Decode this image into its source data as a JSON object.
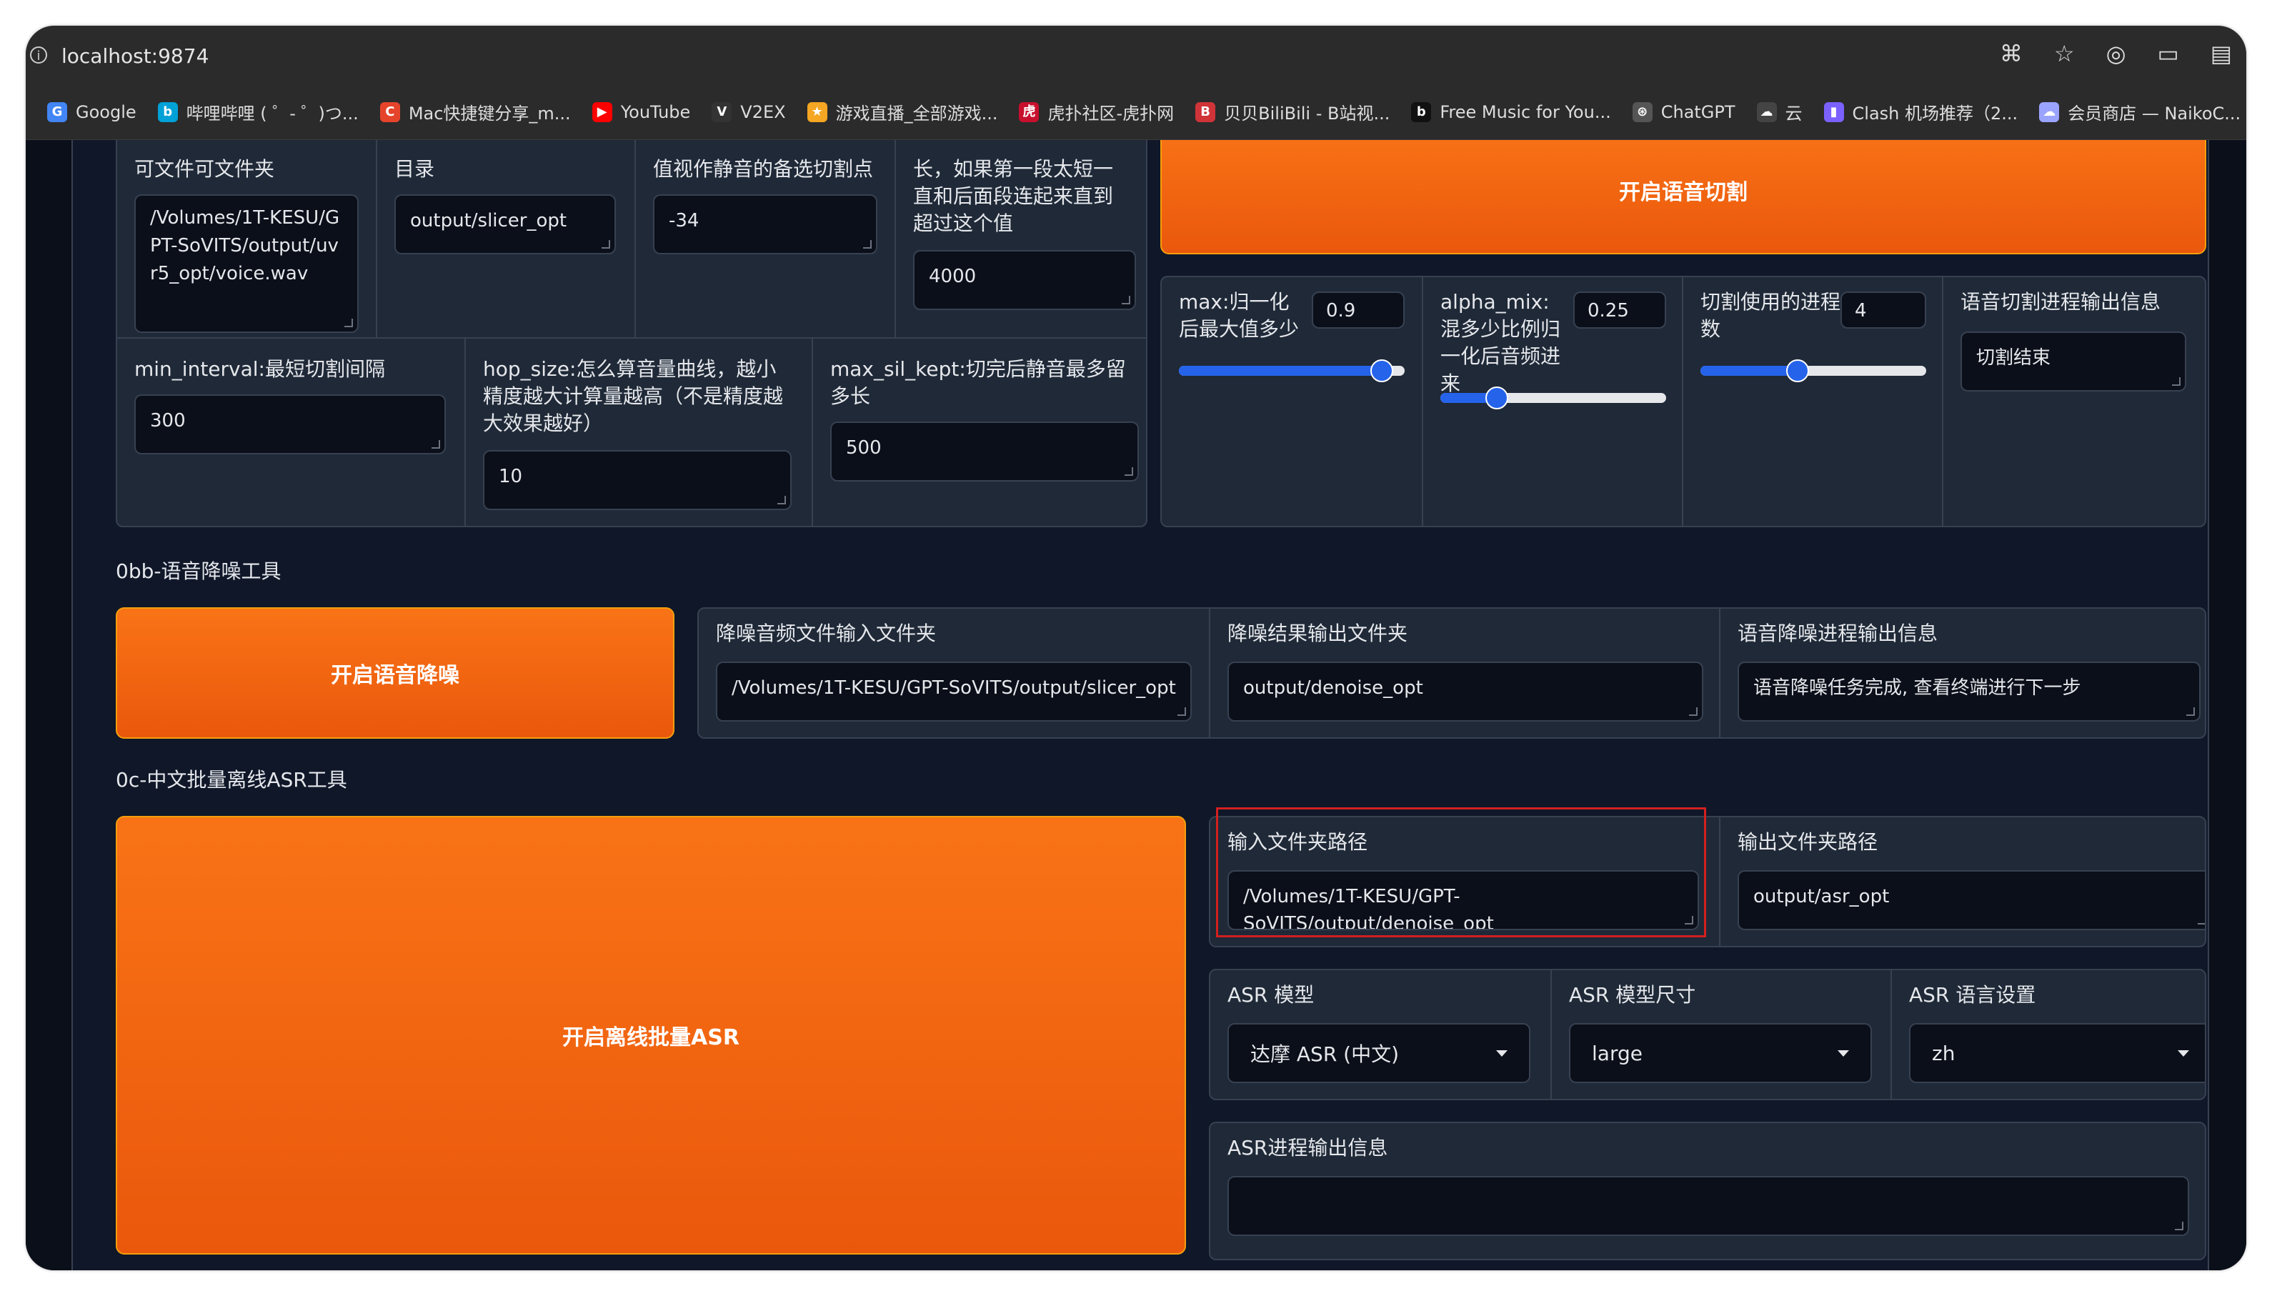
{
  "browser": {
    "url": "localhost:9874",
    "bookmarks": [
      {
        "label": "Google",
        "icon": "google-icon",
        "color": "#4285f4",
        "glyph": "G"
      },
      {
        "label": "哔哩哔哩 ( ゜- ゜)つ...",
        "icon": "bilibili-icon",
        "color": "#00a1d6",
        "glyph": "b"
      },
      {
        "label": "Mac快捷键分享_m...",
        "icon": "c-icon",
        "color": "#e5442b",
        "glyph": "C"
      },
      {
        "label": "YouTube",
        "icon": "youtube-icon",
        "color": "#ff0000",
        "glyph": "▶"
      },
      {
        "label": "V2EX",
        "icon": "v2ex-icon",
        "color": "#333333",
        "glyph": "V"
      },
      {
        "label": "游戏直播_全部游戏...",
        "icon": "game-icon",
        "color": "#f5a623",
        "glyph": "★"
      },
      {
        "label": "虎扑社区-虎扑网",
        "icon": "hupu-icon",
        "color": "#c8102e",
        "glyph": "虎"
      },
      {
        "label": "贝贝BiliBili - B站视...",
        "icon": "bilibili2-icon",
        "color": "#d13438",
        "glyph": "B"
      },
      {
        "label": "Free Music for You...",
        "icon": "music-icon",
        "color": "#111111",
        "glyph": "b"
      },
      {
        "label": "ChatGPT",
        "icon": "chatgpt-icon",
        "color": "#555555",
        "glyph": "⊛"
      },
      {
        "label": "云",
        "icon": "cloud-icon",
        "color": "#444444",
        "glyph": "☁"
      },
      {
        "label": "Clash 机场推荐（2...",
        "icon": "clash-icon",
        "color": "#7b61ff",
        "glyph": "▮"
      },
      {
        "label": "会员商店 — NaikoC...",
        "icon": "store-icon",
        "color": "#9aa4ff",
        "glyph": "☁"
      }
    ]
  },
  "slicer": {
    "col1_label": "可文件可文件夹",
    "col1_value": "/Volumes/1T-KESU/GPT-SoVITS/output/uvr5_opt/voice.wav",
    "col2_label": "目录",
    "col2_value": "output/slicer_opt",
    "col3_label": "值视作静音的备选切割点",
    "col3_value": "-34",
    "col4_label": "长，如果第一段太短一直和后面段连起来直到超过这个值",
    "col4_value": "4000",
    "min_interval_label": "min_interval:最短切割间隔",
    "min_interval_value": "300",
    "hop_size_label": "hop_size:怎么算音量曲线，越小精度越大计算量越高（不是精度越大效果越好）",
    "hop_size_value": "10",
    "max_sil_label": "max_sil_kept:切完后静音最多留多长",
    "max_sil_value": "500",
    "button": "开启语音切割",
    "max_label": "max:归一化后最大值多少",
    "max_value": "0.9",
    "max_fraction": 0.9,
    "alpha_label": "alpha_mix:混多少比例归一化后音频进来",
    "alpha_value": "0.25",
    "alpha_fraction": 0.25,
    "proc_label": "切割使用的进程数",
    "proc_value": "4",
    "proc_fraction": 0.43,
    "output_label": "语音切割进程输出信息",
    "output_value": "切割结束"
  },
  "denoise": {
    "title": "0bb-语音降噪工具",
    "button": "开启语音降噪",
    "input_label": "降噪音频文件输入文件夹",
    "input_value": "/Volumes/1T-KESU/GPT-SoVITS/output/slicer_opt",
    "output_label": "降噪结果输出文件夹",
    "output_value": "output/denoise_opt",
    "info_label": "语音降噪进程输出信息",
    "info_value": "语音降噪任务完成, 查看终端进行下一步"
  },
  "asr": {
    "title": "0c-中文批量离线ASR工具",
    "button": "开启离线批量ASR",
    "input_label": "输入文件夹路径",
    "input_value": "/Volumes/1T-KESU/GPT-SoVITS/output/denoise_opt",
    "output_label": "输出文件夹路径",
    "output_value": "output/asr_opt",
    "model_label": "ASR 模型",
    "model_value": "达摩 ASR (中文)",
    "size_label": "ASR 模型尺寸",
    "size_value": "large",
    "lang_label": "ASR 语言设置",
    "lang_value": "zh",
    "info_label": "ASR进程输出信息",
    "info_value": ""
  },
  "colors": {
    "accent": "#f97316",
    "slider": "#2563eb",
    "highlight": "#d31f1f"
  }
}
